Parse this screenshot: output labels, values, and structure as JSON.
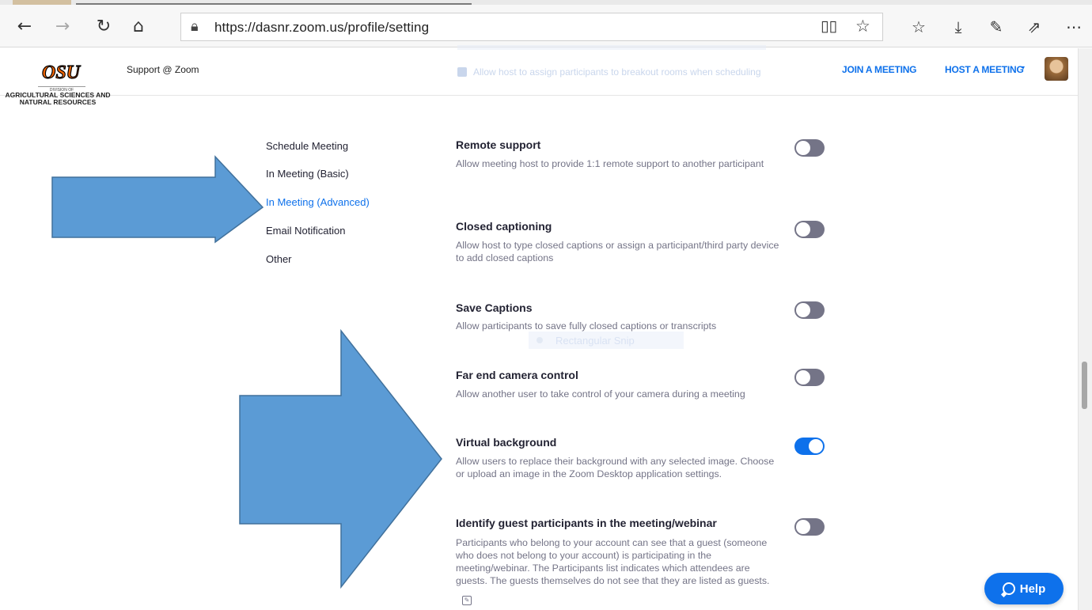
{
  "browser": {
    "url": "https://dasnr.zoom.us/profile/setting",
    "icons": {
      "back": "back-arrow-icon",
      "forward": "forward-arrow-icon",
      "refresh": "refresh-icon",
      "home": "home-icon",
      "lock": "lock-icon",
      "reading_view": "reading-view-icon",
      "favorite": "star-icon",
      "favorites_list": "favorites-icon",
      "downloads": "download-icon",
      "pen": "pen-icon",
      "share": "share-icon",
      "more": "more-icon"
    }
  },
  "header": {
    "logo_text": "OSU",
    "logo_division": "DIVISION OF",
    "logo_sub": "AGRICULTURAL SCIENCES AND NATURAL RESOURCES",
    "title": "Support @ Zoom",
    "ghost_text": "Allow host to assign participants to breakout rooms when scheduling",
    "join_meeting": "JOIN A MEETING",
    "host_meeting": "HOST A MEETING",
    "host_caret": "▾"
  },
  "nav": {
    "items": [
      {
        "label": "Schedule Meeting",
        "active": false
      },
      {
        "label": "In Meeting (Basic)",
        "active": false
      },
      {
        "label": "In Meeting (Advanced)",
        "active": true
      },
      {
        "label": "Email Notification",
        "active": false
      },
      {
        "label": "Other",
        "active": false
      }
    ]
  },
  "settings": [
    {
      "title": "Remote support",
      "description": "Allow meeting host to provide 1:1 remote support to another participant",
      "enabled": false
    },
    {
      "title": "Closed captioning",
      "description": "Allow host to type closed captions or assign a participant/third party device to add closed captions",
      "enabled": false
    },
    {
      "title": "Save Captions",
      "description": "Allow participants to save fully closed captions or transcripts",
      "enabled": false
    },
    {
      "title": "Far end camera control",
      "description": "Allow another user to take control of your camera during a meeting",
      "enabled": false
    },
    {
      "title": "Virtual background",
      "description": "Allow users to replace their background with any selected image. Choose or upload an image in the Zoom Desktop application settings.",
      "enabled": true
    },
    {
      "title": "Identify guest participants in the meeting/webinar",
      "description": "Participants who belong to your account can see that a guest (someone who does not belong to your account) is participating in the meeting/webinar. The Participants list indicates which attendees are guests. The guests themselves do not see that they are listed as guests.",
      "enabled": false
    }
  ],
  "overlay": {
    "snip_text": "Rectangular Snip"
  },
  "help": {
    "label": "Help"
  },
  "colors": {
    "accent": "#0e71eb",
    "toggle_off": "#747487",
    "arrow_fill": "#5b9bd5",
    "arrow_stroke": "#41719c",
    "osu_orange": "#f56600"
  }
}
